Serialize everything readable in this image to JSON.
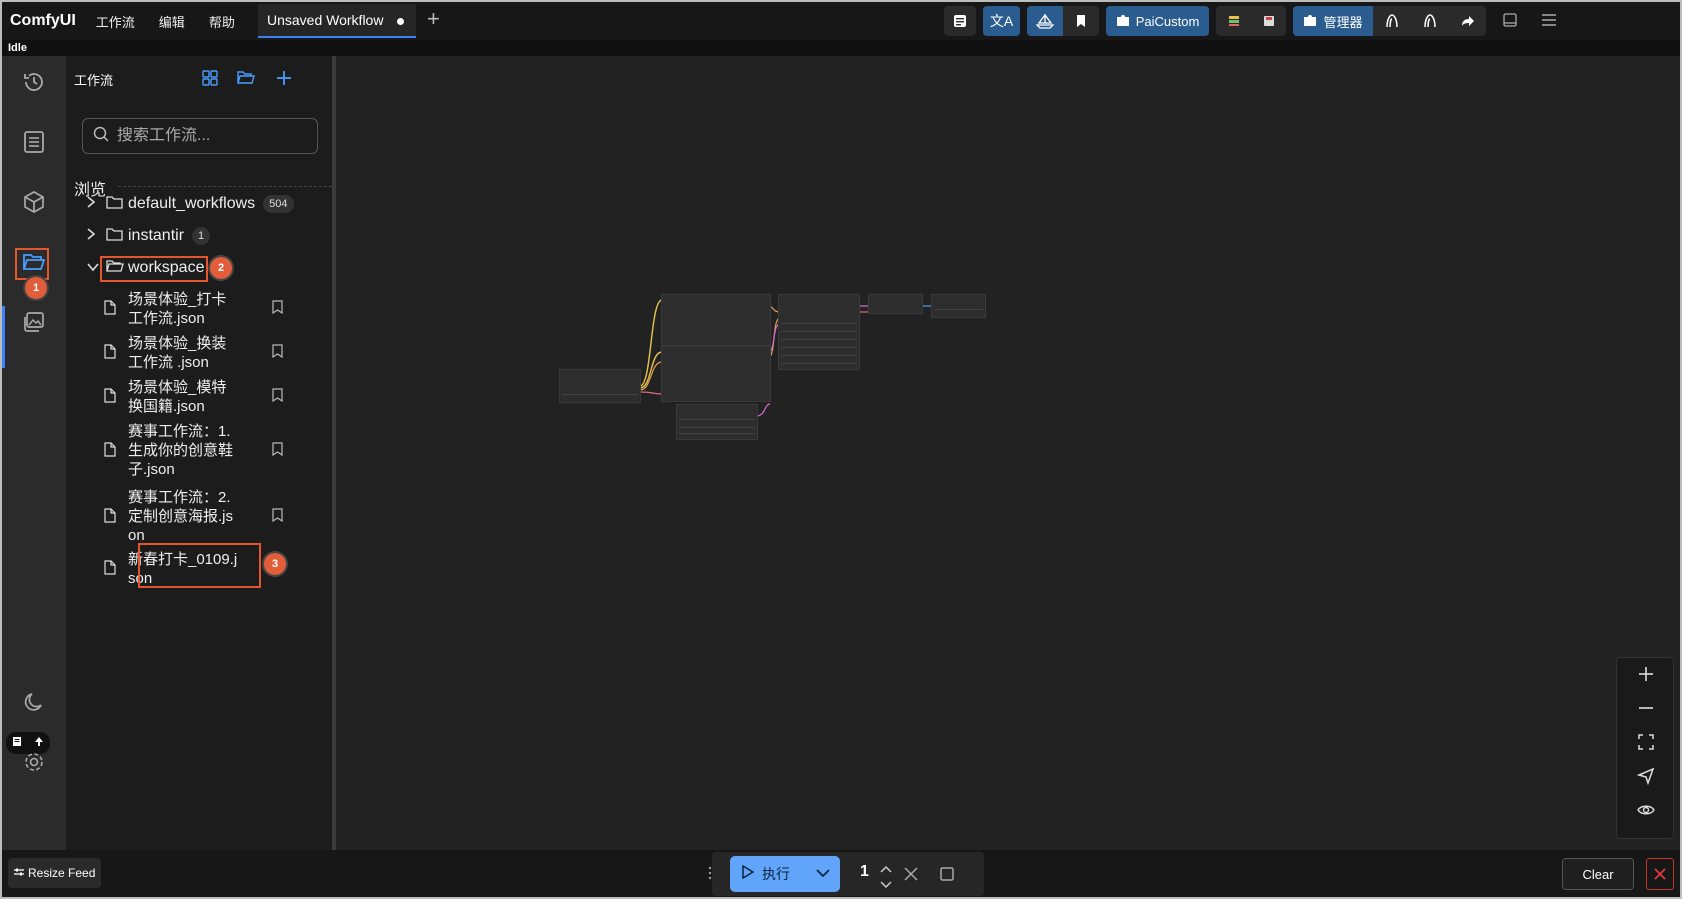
{
  "app": {
    "logo": "ComfyUI",
    "status": "Idle"
  },
  "menu": [
    "工作流",
    "编辑",
    "帮助"
  ],
  "tab": {
    "label": "Unsaved Workflow",
    "modified": true
  },
  "toolbar": {
    "paicustom_label": "PaiCustom",
    "manager_label": "管理器"
  },
  "sidebar": {
    "title": "工作流",
    "search_placeholder": "搜索工作流...",
    "browse_label": "浏览",
    "folders": [
      {
        "name": "default_workflows",
        "count": "504",
        "expanded": false
      },
      {
        "name": "instantir",
        "count": "1",
        "expanded": false
      },
      {
        "name": "workspace",
        "count": "",
        "expanded": true
      }
    ],
    "files": [
      {
        "line1": "场景体验_打卡",
        "line2": "工作流.json",
        "line3": ""
      },
      {
        "line1": "场景体验_换装",
        "line2": "工作流 .json",
        "line3": ""
      },
      {
        "line1": "场景体验_模特",
        "line2": "换国籍.json",
        "line3": ""
      },
      {
        "line1": "赛事工作流：1.",
        "line2": "生成你的创意鞋",
        "line3": "子.json"
      },
      {
        "line1": "赛事工作流：2.",
        "line2": "定制创意海报.js",
        "line3": "on"
      },
      {
        "line1": "新春打卡_0109.j",
        "line2": "son",
        "line3": ""
      }
    ]
  },
  "annotations": [
    "1",
    "2",
    "3"
  ],
  "bottom": {
    "resize_feed": "Resize Feed",
    "run_label": "执行",
    "run_count": "1",
    "clear_label": "Clear"
  },
  "colors": {
    "accent": "#3b82f6",
    "annotation": "#e4572e",
    "run": "#60a5fa"
  }
}
